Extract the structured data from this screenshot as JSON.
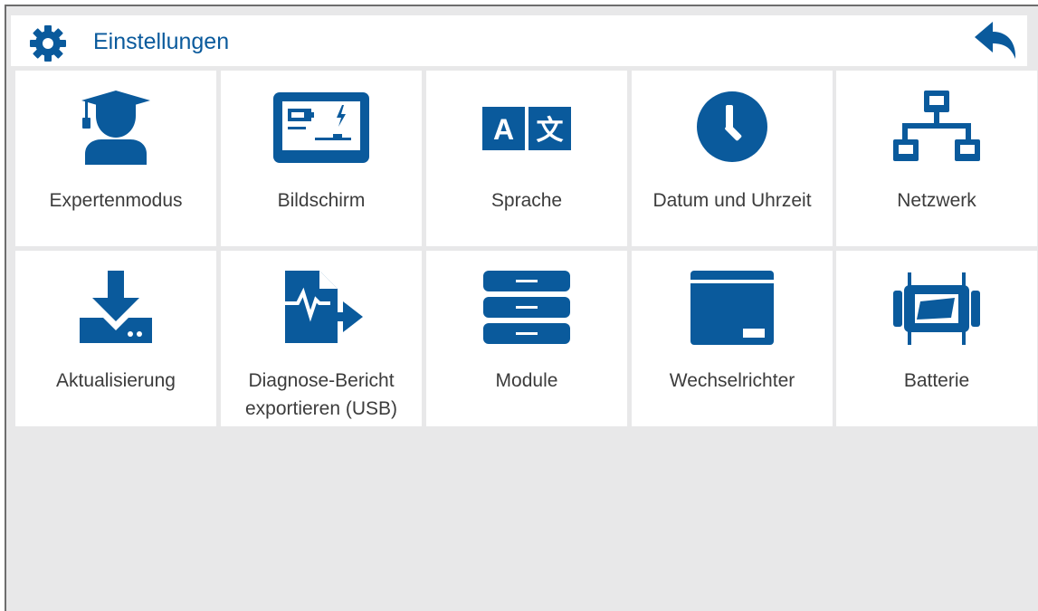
{
  "header": {
    "title": "Einstellungen",
    "icon": "gear-icon",
    "back_icon": "back-arrow-icon"
  },
  "tiles": [
    {
      "label": "Expertenmodus",
      "icon": "graduate-icon"
    },
    {
      "label": "Bildschirm",
      "icon": "display-icon"
    },
    {
      "label": "Sprache",
      "icon": "translate-icon"
    },
    {
      "label": "Datum und Uhrzeit",
      "icon": "clock-icon"
    },
    {
      "label": "Netzwerk",
      "icon": "network-icon"
    },
    {
      "label": "Aktualisierung",
      "icon": "download-icon"
    },
    {
      "label": "Diagnose-Bericht",
      "label2": "exportieren (USB)",
      "icon": "diagnostic-export-icon"
    },
    {
      "label": "Module",
      "icon": "modules-icon"
    },
    {
      "label": "Wechselrichter",
      "icon": "inverter-icon"
    },
    {
      "label": "Batterie",
      "icon": "battery-icon"
    }
  ],
  "colors": {
    "accent": "#0a5a9c",
    "background": "#e8e8e9",
    "tile": "#ffffff",
    "text": "#3c3c3c"
  }
}
